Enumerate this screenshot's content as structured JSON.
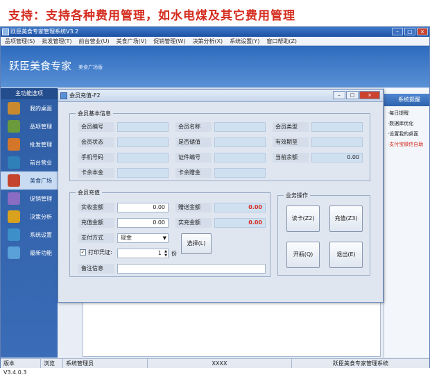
{
  "banner": {
    "text": "支持：支持各种费用管理，如水电煤及其它费用管理"
  },
  "app": {
    "title": "跃臣美食专家管理系统V3.2",
    "menu": [
      "品项管理(S)",
      "批发管理(T)",
      "前台营业(U)",
      "美食广场(V)",
      "促销管理(W)",
      "决策分析(X)",
      "系统设置(Y)",
      "窗口帮助(Z)"
    ],
    "brand": "跃臣美食专家",
    "brand_sub": "美食广场版"
  },
  "sidebar": {
    "title": "主功能选项",
    "items": [
      {
        "label": "我的桌面",
        "icon": "home-icon",
        "color": "#c98a2f"
      },
      {
        "label": "品项管理",
        "icon": "document-add-icon",
        "color": "#6a9a3c"
      },
      {
        "label": "批发管理",
        "icon": "truck-icon",
        "color": "#d4762a"
      },
      {
        "label": "前台营业",
        "icon": "cash-register-icon",
        "color": "#2f7fb8"
      },
      {
        "label": "美食广场",
        "icon": "food-tray-icon",
        "color": "#c4452f"
      },
      {
        "label": "促销管理",
        "icon": "chart-line-icon",
        "color": "#8a6cc2"
      },
      {
        "label": "决策分析",
        "icon": "bar-chart-icon",
        "color": "#d9a21e"
      },
      {
        "label": "系统设置",
        "icon": "computer-settings-icon",
        "color": "#3c8fc9"
      },
      {
        "label": "最新功能",
        "icon": "document-search-icon",
        "color": "#5aa0d8"
      }
    ]
  },
  "right_panel": {
    "title": "系统提醒",
    "items": [
      "·每日提醒",
      "·数据库优化",
      "·设置我的桌面",
      "·支付宝微信自助"
    ]
  },
  "dialog": {
    "title": "会员充值-F2",
    "basic_info": {
      "legend": "会员基本信息",
      "labels": [
        "会员编号",
        "会员名称",
        "会员类型",
        "会员状态",
        "是否储值",
        "有效期至",
        "手机号码",
        "证件编号",
        "当前余额",
        "卡余本金",
        "卡余赠金"
      ],
      "current_balance": "0.00"
    },
    "recharge": {
      "legend": "会员充值",
      "received_label": "实收金额",
      "received_value": "0.00",
      "gift_label": "赠送金额",
      "gift_value": "0.00",
      "recharge_label": "充值金额",
      "recharge_value": "0.00",
      "actual_label": "实充金额",
      "actual_value": "0.00",
      "pay_method_label": "支付方式",
      "pay_method_value": "现金",
      "print_label": "打印凭证:",
      "print_checked": "✓",
      "copies_value": "1",
      "copies_unit": "份",
      "choose_label": "选择(L)",
      "note_label": "备注信息"
    },
    "operations": {
      "legend": "业务操作",
      "read_card": "读卡(Z2)",
      "recharge": "充值(Z3)",
      "drawer": "开瓶(Q)",
      "exit": "退出(E)"
    }
  },
  "statusbar": [
    "版本 V3.4.0.3",
    "浏览",
    "系统管理员",
    "XXXX",
    "跃臣美食专家管理系统"
  ]
}
